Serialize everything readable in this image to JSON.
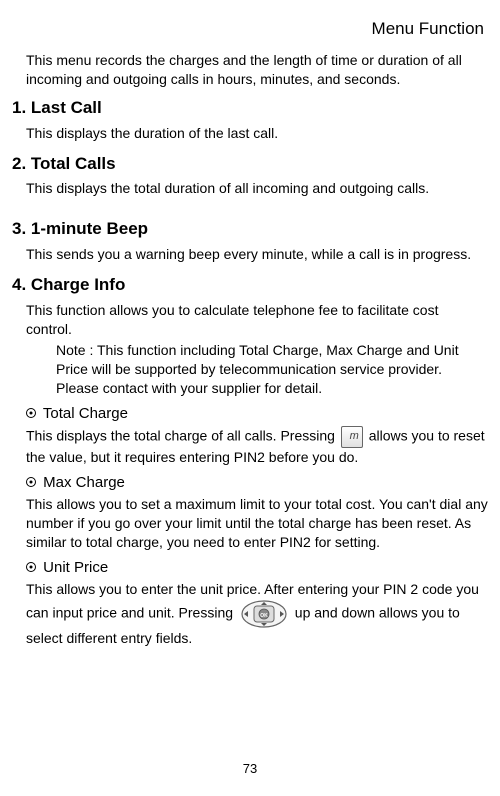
{
  "header": "Menu Function",
  "intro": "This menu records the charges and the length of time or duration of all incoming and outgoing calls in hours, minutes, and seconds.",
  "sections": {
    "s1": {
      "heading": "1. Last Call",
      "body": "This displays the duration of the last call."
    },
    "s2": {
      "heading": "2. Total Calls",
      "body": "This displays the total duration of all incoming and outgoing calls."
    },
    "s3": {
      "heading": "3. 1-minute Beep",
      "body": "This sends you a warning beep every minute, while a call is in progress."
    },
    "s4": {
      "heading": "4. Charge Info",
      "body": "This function allows you to calculate telephone fee to facilitate cost control.",
      "note": "Note : This function including Total Charge, Max Charge and Unit Price will be supported by telecommunication service provider. Please contact with your supplier for detail.",
      "sub1": {
        "heading": "Total Charge",
        "body_part1": "This displays the total charge of all calls. Pressing ",
        "body_part2": " allows you to reset the value, but it requires entering PIN2 before you do."
      },
      "sub2": {
        "heading": "Max Charge",
        "body": "This allows you to set a maximum limit to your total cost. You can't dial any number if you go over your limit until the total charge has been reset. As similar to total charge, you need to enter PIN2 for setting."
      },
      "sub3": {
        "heading": "Unit Price",
        "body_part1": "This allows you to enter the unit price. After entering your PIN 2 code you can input price and unit. Pressing ",
        "body_part2": " up and down allows you to select different entry fields."
      }
    }
  },
  "page_number": "73"
}
